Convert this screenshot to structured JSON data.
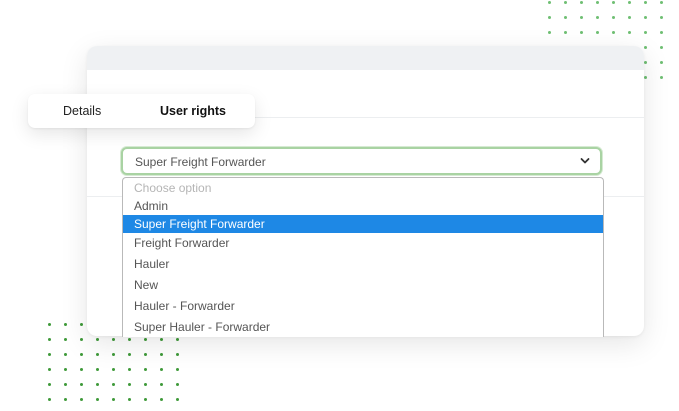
{
  "tabs": {
    "details": "Details",
    "user_rights": "User rights"
  },
  "role_select": {
    "value": "Super Freight Forwarder",
    "options": [
      "Choose option",
      "Admin",
      "Super Freight Forwarder",
      "Freight Forwarder",
      "Hauler",
      "New",
      "Hauler - Forwarder",
      "Super Hauler - Forwarder"
    ],
    "selected_option": "Super Freight Forwarder"
  },
  "colors": {
    "accent": "#1e88e5",
    "select_border": "#a9d3a3",
    "dots": "#6fbf73"
  },
  "icons": {
    "select_arrow": "chevron-down-icon"
  }
}
